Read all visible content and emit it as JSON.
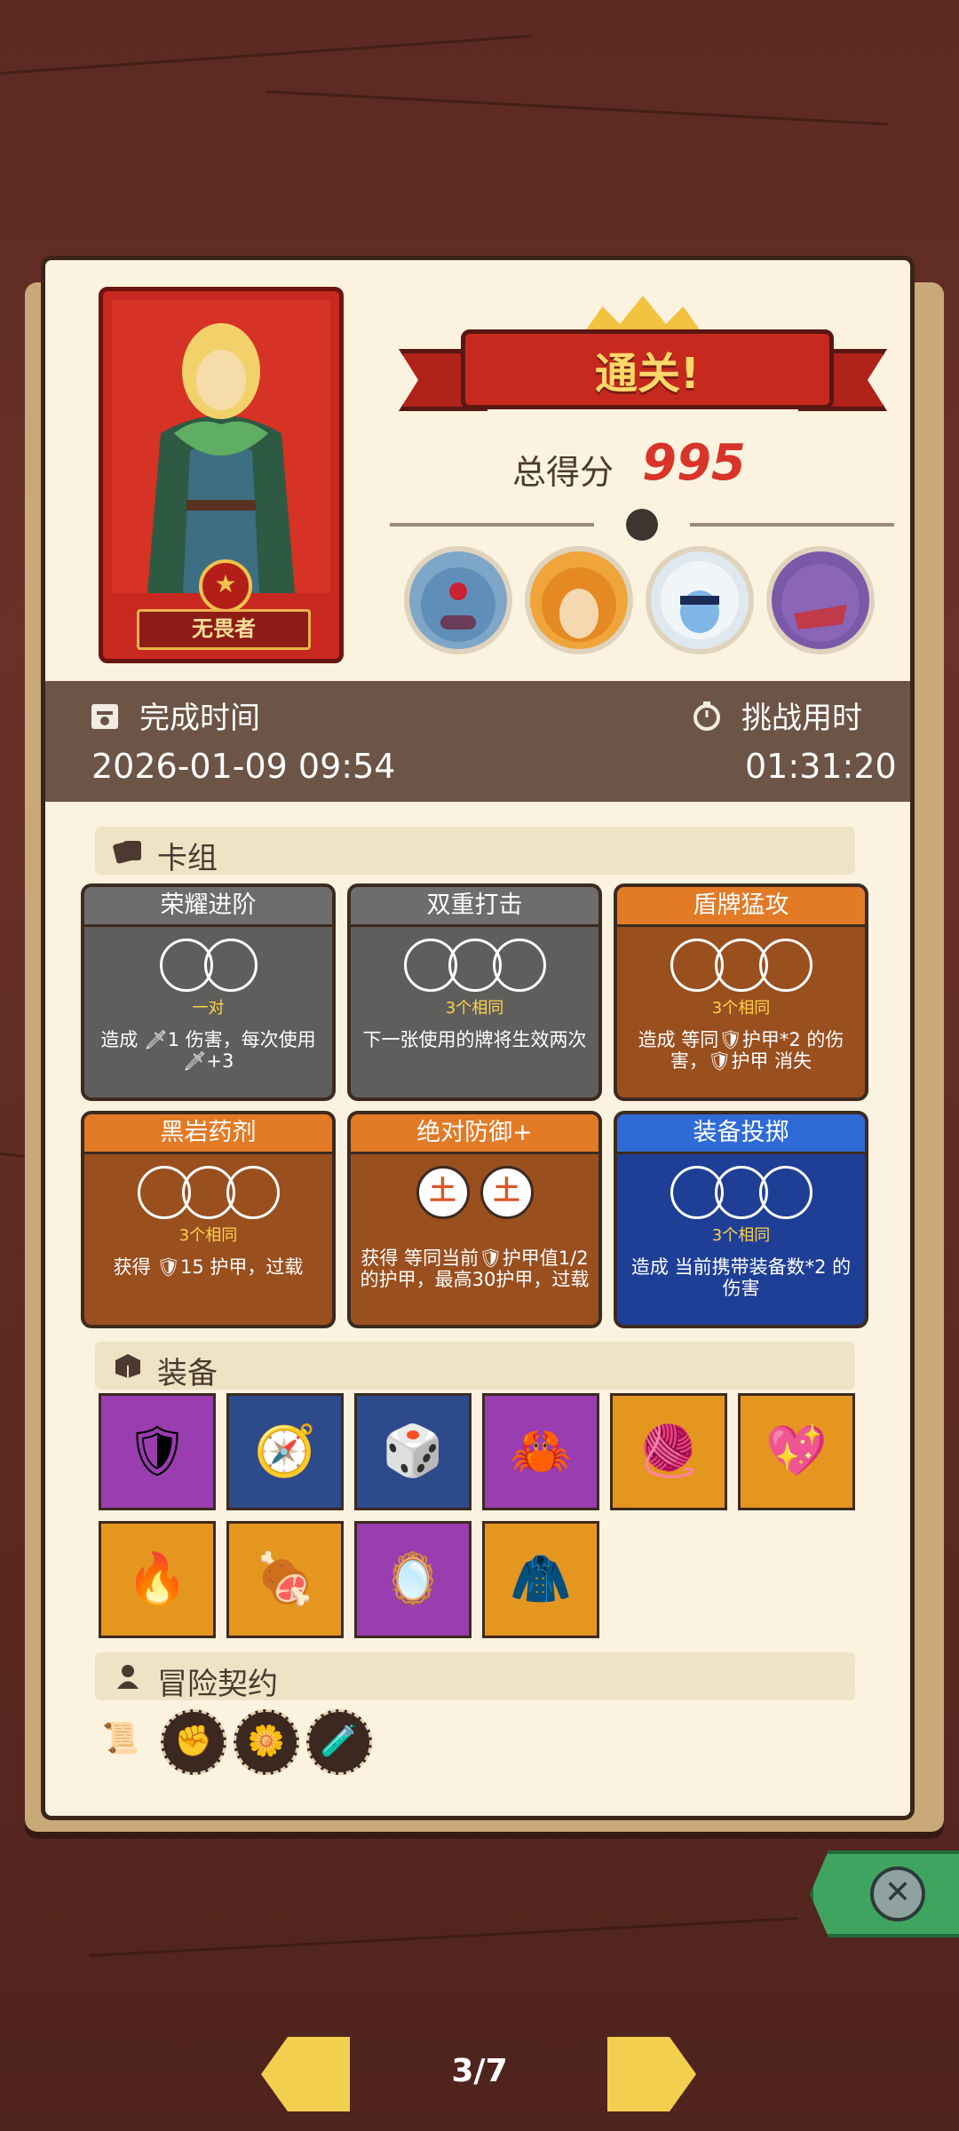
{
  "result": {
    "banner": "通关!",
    "score_label": "总得分",
    "score_value": "995"
  },
  "hero": {
    "name": "无畏者"
  },
  "bosses": [
    "blue-monster-boss-portrait",
    "orange-beast-boss-portrait",
    "white-yeti-boss-portrait",
    "purple-dragon-boss-portrait"
  ],
  "info": {
    "finish_label": "完成时间",
    "finish_value": "2026-01-09 09:54",
    "challenge_label": "挑战用时",
    "challenge_value": "01:31:20"
  },
  "deck": {
    "title": "卡组",
    "cards": [
      {
        "title": "荣耀进阶",
        "sub": "一对",
        "desc": "造成 🗡1 伤害，每次使用🗡+3",
        "style": "gray",
        "circles": 2
      },
      {
        "title": "双重打击",
        "sub": "3个相同",
        "desc": "下一张使用的牌将生效两次",
        "style": "gray",
        "circles": 3
      },
      {
        "title": "盾牌猛攻",
        "sub": "3个相同",
        "desc": "造成 等同🛡护甲*2 的伤害，🛡护甲 消失",
        "style": "orange",
        "circles": 3
      },
      {
        "title": "黑岩药剂",
        "sub": "3个相同",
        "desc": "获得 🛡15 护甲，过载",
        "style": "orange",
        "circles": 3
      },
      {
        "title": "绝对防御+",
        "sub": "",
        "desc": "获得 等同当前🛡护甲值1/2的护甲，最高30护甲，过载",
        "style": "orange",
        "circles": 2,
        "circle_glyph": "土"
      },
      {
        "title": "装备投掷",
        "sub": "3个相同",
        "desc": "造成 当前携带装备数*2 的伤害",
        "style": "blue",
        "circles": 3
      }
    ]
  },
  "equipment": {
    "title": "装备",
    "items": [
      {
        "icon": "lion-shield-icon",
        "glyph": "🛡",
        "bg": "purple"
      },
      {
        "icon": "compass-armor-icon",
        "glyph": "🧭",
        "bg": "navy"
      },
      {
        "icon": "pink-dice-icon",
        "glyph": "🎲",
        "bg": "navy"
      },
      {
        "icon": "crab-amulet-icon",
        "glyph": "🦀",
        "bg": "purple"
      },
      {
        "icon": "sweater-icon",
        "glyph": "🧶",
        "bg": "orange"
      },
      {
        "icon": "heart-icon",
        "glyph": "💖",
        "bg": "orange"
      },
      {
        "icon": "fire-spirit-icon",
        "glyph": "🔥",
        "bg": "orange"
      },
      {
        "icon": "meat-plate-icon",
        "glyph": "🍖",
        "bg": "orange"
      },
      {
        "icon": "magic-mirror-icon",
        "glyph": "🪞",
        "bg": "purple"
      },
      {
        "icon": "black-cloak-icon",
        "glyph": "🧥",
        "bg": "orange"
      }
    ]
  },
  "contract": {
    "title": "冒险契约",
    "items": [
      {
        "icon": "scroll-icon",
        "glyph": "📜"
      },
      {
        "icon": "fist-badge-icon",
        "glyph": "✊"
      },
      {
        "icon": "flower-pot-icon",
        "glyph": "🌼"
      },
      {
        "icon": "potion-bottle-icon",
        "glyph": "🧪"
      }
    ]
  },
  "pager": {
    "label": "3/7"
  }
}
